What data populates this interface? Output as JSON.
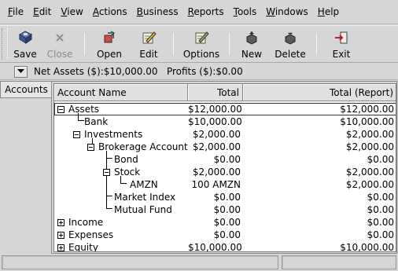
{
  "menu": [
    {
      "first": "F",
      "rest": "ile"
    },
    {
      "first": "E",
      "rest": "dit"
    },
    {
      "first": "V",
      "rest": "iew"
    },
    {
      "first": "A",
      "rest": "ctions"
    },
    {
      "first": "B",
      "rest": "usiness"
    },
    {
      "first": "R",
      "rest": "eports"
    },
    {
      "first": "T",
      "rest": "ools"
    },
    {
      "first": "W",
      "rest": "indows"
    },
    {
      "first": "H",
      "rest": "elp"
    }
  ],
  "toolbar": {
    "save": "Save",
    "close": "Close",
    "open": "Open",
    "edit": "Edit",
    "options": "Options",
    "new": "New",
    "delete": "Delete",
    "exit": "Exit"
  },
  "summary": {
    "text": "Net Assets ($):$10,000.00   Profits ($):$0.00"
  },
  "tab": {
    "label": "Accounts"
  },
  "columns": {
    "name": "Account Name",
    "total": "Total",
    "total_report": "Total (Report)"
  },
  "accounts": [
    {
      "name": "Assets",
      "total": "$12,000.00",
      "report": "$12,000.00"
    },
    {
      "name": "Bank",
      "total": "$10,000.00",
      "report": "$10,000.00"
    },
    {
      "name": "Investments",
      "total": "$2,000.00",
      "report": "$2,000.00"
    },
    {
      "name": "Brokerage Account",
      "total": "$2,000.00",
      "report": "$2,000.00"
    },
    {
      "name": "Bond",
      "total": "$0.00",
      "report": "$0.00"
    },
    {
      "name": "Stock",
      "total": "$2,000.00",
      "report": "$2,000.00"
    },
    {
      "name": "AMZN",
      "total": "100 AMZN",
      "report": "$2,000.00"
    },
    {
      "name": "Market Index",
      "total": "$0.00",
      "report": "$0.00"
    },
    {
      "name": "Mutual Fund",
      "total": "$0.00",
      "report": "$0.00"
    },
    {
      "name": "Income",
      "total": "$0.00",
      "report": "$0.00"
    },
    {
      "name": "Expenses",
      "total": "$0.00",
      "report": "$0.00"
    },
    {
      "name": "Equity",
      "total": "$10,000.00",
      "report": "$10,000.00"
    }
  ],
  "colors": {
    "window_bg": "#d6d6d6",
    "tree_bg": "#ffffff"
  }
}
